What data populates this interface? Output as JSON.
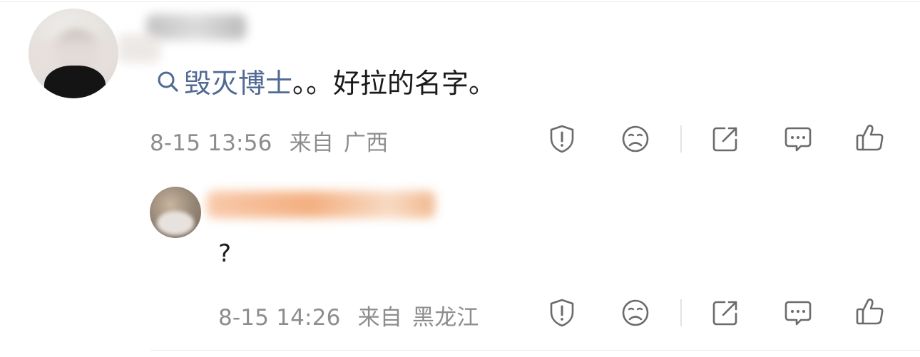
{
  "comment": {
    "link_text": "毁灭博士",
    "text_rest": "。。好拉的名字。",
    "time": "8-15 13:56",
    "source_prefix": "来自",
    "location": "广西"
  },
  "reply": {
    "text": "?",
    "time": "8-15 14:26",
    "source_prefix": "来自",
    "location": "黑龙江"
  },
  "icons": {
    "report": "shield-alert-icon",
    "dislike": "sad-face-icon",
    "share": "share-icon",
    "reply": "comment-icon",
    "like": "thumbs-up-icon"
  },
  "colors": {
    "link": "#506a93",
    "meta": "#8d8d8d",
    "icon": "#6b6b6b"
  }
}
